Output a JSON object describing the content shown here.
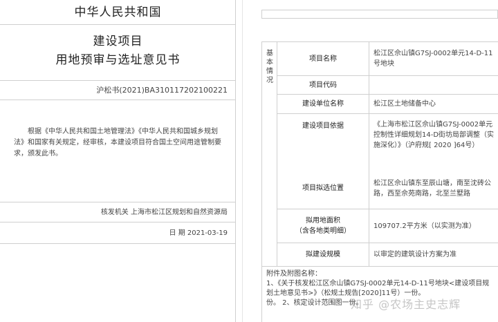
{
  "certificate": {
    "country": "中华人民共和国",
    "title_line1": "建设项目",
    "title_line2": "用地预审与选址意见书",
    "cert_no": "沪松书(2021)BA310117202100221",
    "body": "根据《中华人民共和国土地管理法》《中华人民共和国城乡规划法》和国家有关规定，经审核，本建设项目符合国土空间用途管制要求，颁发此书。",
    "issuer": "核发机关 上海市松江区规划和自然资源局",
    "date": "日 期 2021-03-19"
  },
  "table": {
    "category": [
      "基",
      "本",
      "情",
      "况"
    ],
    "rows": [
      {
        "label": "项目名称",
        "value": "松江区佘山镇G7SJ-0002单元14-D-11号地块"
      },
      {
        "label": "项目代码",
        "value": ""
      },
      {
        "label": "建设单位名称",
        "value": "松江区土地储备中心"
      },
      {
        "label": "建设项目依据",
        "value": "《上海市松江区佘山镇G7SJ-0002单元控制性详细规划14-D街坊局部调整（实施深化）》（沪府规[ 2020 ]64号）"
      },
      {
        "label": "项目拟选位置",
        "value": "松江区佘山镇东至辰山塘，南至沈砖公路，西至佘苑南路，北至兰墅路"
      },
      {
        "label": "拟用地面积\n（含各地类明细）",
        "value": "109707.2平方米（以实测为准）"
      },
      {
        "label": "拟建设规模",
        "value": "以审定的建筑设计方案为准"
      }
    ],
    "attachments": {
      "title": "附件及附图名称：",
      "line1": "1、《关于核发松江区佘山镇G7SJ-0002单元14-D-11号地块<建设项目规划土地意见书>》（松规土规告[2020]11号）一份。",
      "line2": "份。 2、核定设计范围图一份。"
    }
  },
  "watermark": "知乎 @农场主史志辉"
}
